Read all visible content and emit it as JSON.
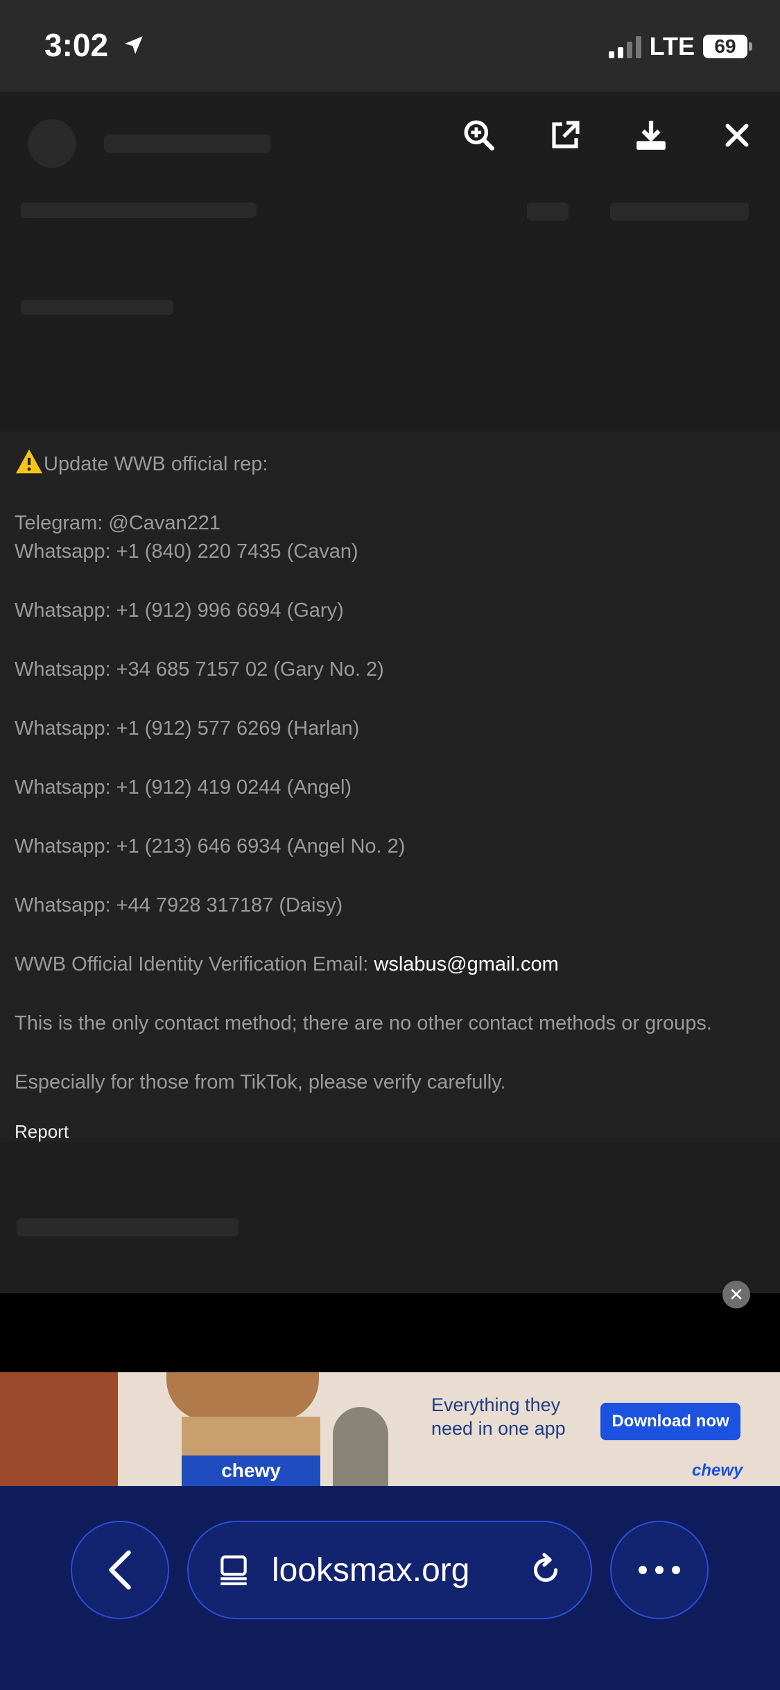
{
  "status_bar": {
    "time": "3:02",
    "network": "LTE",
    "battery": "69"
  },
  "viewer": {
    "toolbar_icons": [
      "zoom-in-icon",
      "open-external-icon",
      "download-icon",
      "close-icon"
    ]
  },
  "post": {
    "warning_icon": "warning-icon",
    "heading": "Update WWB official rep:",
    "lines": [
      "Telegram: @Cavan221",
      "Whatsapp: +1 (840) 220 7435 (Cavan)",
      "Whatsapp: +1 (912) 996 6694 (Gary)",
      "Whatsapp: +34 685 7157 02 (Gary No. 2)",
      "Whatsapp: +1 (912) 577 6269 (Harlan)",
      "Whatsapp: +1 (912) 419 0244 (Angel)",
      "Whatsapp: +1 (213) 646 6934 (Angel No. 2)",
      "Whatsapp: +44 7928 317187 (Daisy)"
    ],
    "email_label": "WWB Official Identity Verification Email: ",
    "email": "wslabus@gmail.com",
    "note_1": "This is the only contact method; there are no other contact methods or groups.",
    "note_2": "Especially for those from TikTok, please verify carefully.",
    "report_label": "Report"
  },
  "ad": {
    "close_icon": "close-icon",
    "box_label": "chewy",
    "text": "Everything they need in one app",
    "button": "Download now",
    "brand": "chewy"
  },
  "browser_bar": {
    "url": "looksmax.org",
    "icons": [
      "back-icon",
      "tabs-icon",
      "reload-icon",
      "more-icon"
    ]
  },
  "colors": {
    "background": "#222222",
    "text": "#9a9a9a",
    "email": "#ffffff",
    "bottom_bar": "#0f1d5d",
    "accent": "#1c52e0"
  }
}
